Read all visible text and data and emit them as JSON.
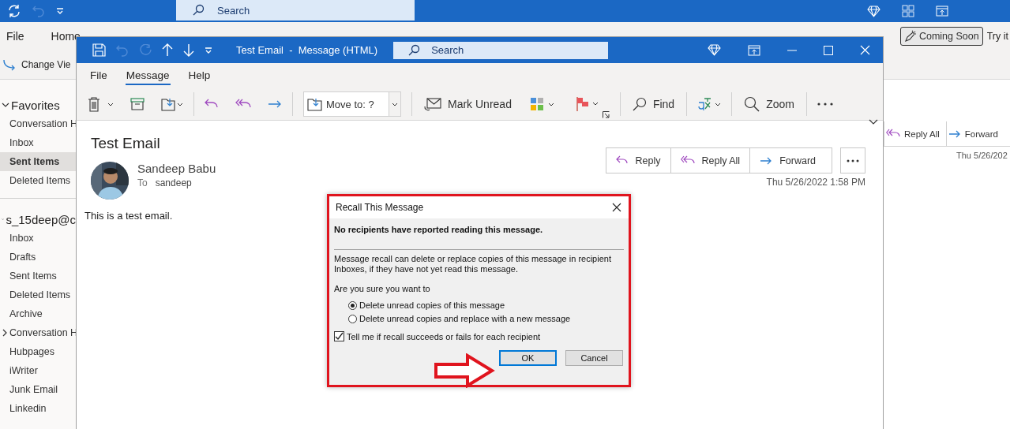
{
  "app": {
    "quick_access": [
      {
        "kind": "sync",
        "disabled": false
      },
      {
        "kind": "undo",
        "disabled": true
      }
    ],
    "search": {
      "placeholder": "Search"
    },
    "menu_tabs": [
      {
        "label": "File",
        "selected": false
      },
      {
        "label": "Home",
        "selected": false
      }
    ],
    "coming_soon": "Coming Soon",
    "try_it": "Try it",
    "change_view": "Change Vie"
  },
  "sidebar": {
    "groups": [
      {
        "label": "Favorites",
        "expanded": true,
        "items": [
          {
            "label": "Conversation H",
            "selected": false,
            "kind": "folder"
          },
          {
            "label": "Inbox",
            "selected": false,
            "kind": "folder"
          },
          {
            "label": "Sent Items",
            "selected": true,
            "kind": "folder"
          },
          {
            "label": "Deleted Items",
            "selected": false,
            "kind": "folder"
          }
        ]
      },
      {
        "label": "s_15deep@c",
        "expanded": true,
        "items": [
          {
            "label": "Inbox",
            "selected": false,
            "kind": "folder"
          },
          {
            "label": "Drafts",
            "selected": false,
            "kind": "folder"
          },
          {
            "label": "Sent Items",
            "selected": false,
            "kind": "folder"
          },
          {
            "label": "Deleted Items",
            "selected": false,
            "kind": "folder"
          },
          {
            "label": "Archive",
            "selected": false,
            "kind": "folder"
          },
          {
            "label": "Conversation H",
            "selected": false,
            "kind": "group"
          },
          {
            "label": "Hubpages",
            "selected": false,
            "kind": "folder"
          },
          {
            "label": "iWriter",
            "selected": false,
            "kind": "folder"
          },
          {
            "label": "Junk Email",
            "selected": false,
            "kind": "folder"
          },
          {
            "label": "Linkedin",
            "selected": false,
            "kind": "folder"
          }
        ]
      }
    ]
  },
  "reading_pane": {
    "buttons": [
      {
        "label": "Reply All",
        "kind": "reply_all"
      },
      {
        "label": "Forward",
        "kind": "forward"
      }
    ],
    "date": "Thu 5/26/202"
  },
  "message_window": {
    "title": "Test Email  -  Message (HTML)",
    "search": {
      "placeholder": "Search"
    },
    "quick_access": [
      {
        "kind": "save",
        "disabled": false
      },
      {
        "kind": "undo",
        "disabled": true
      },
      {
        "kind": "redo",
        "disabled": true
      },
      {
        "kind": "up",
        "disabled": false
      },
      {
        "kind": "down",
        "disabled": false
      }
    ],
    "tabs": [
      {
        "label": "File",
        "selected": false
      },
      {
        "label": "Message",
        "selected": true
      },
      {
        "label": "Help",
        "selected": false
      }
    ],
    "ribbon": {
      "move_to": "Move to: ?",
      "mark_unread": "Mark Unread",
      "find": "Find",
      "zoom": "Zoom"
    },
    "subject": "Test Email",
    "sender": {
      "name": "Sandeep Babu",
      "to_label": "To",
      "to": "sandeep"
    },
    "actions": [
      {
        "label": "Reply",
        "kind": "reply"
      },
      {
        "label": "Reply All",
        "kind": "reply_all"
      },
      {
        "label": "Forward",
        "kind": "forward"
      }
    ],
    "date": "Thu 5/26/2022 1:58 PM",
    "body": "This is a test email."
  },
  "dialog": {
    "title": "Recall This Message",
    "heading": "No recipients have reported reading this message.",
    "description": "Message recall can delete or replace copies of this message in recipient Inboxes, if they have not yet read this message.",
    "question": "Are you sure you want to",
    "options": [
      {
        "label": "Delete unread copies of this message",
        "selected": true
      },
      {
        "label": "Delete unread copies and replace with a new message",
        "selected": false
      }
    ],
    "notify": {
      "label": "Tell me if recall succeeds or fails for each recipient",
      "checked": true
    },
    "buttons": [
      {
        "label": "OK",
        "default": true
      },
      {
        "label": "Cancel",
        "default": false
      }
    ]
  }
}
